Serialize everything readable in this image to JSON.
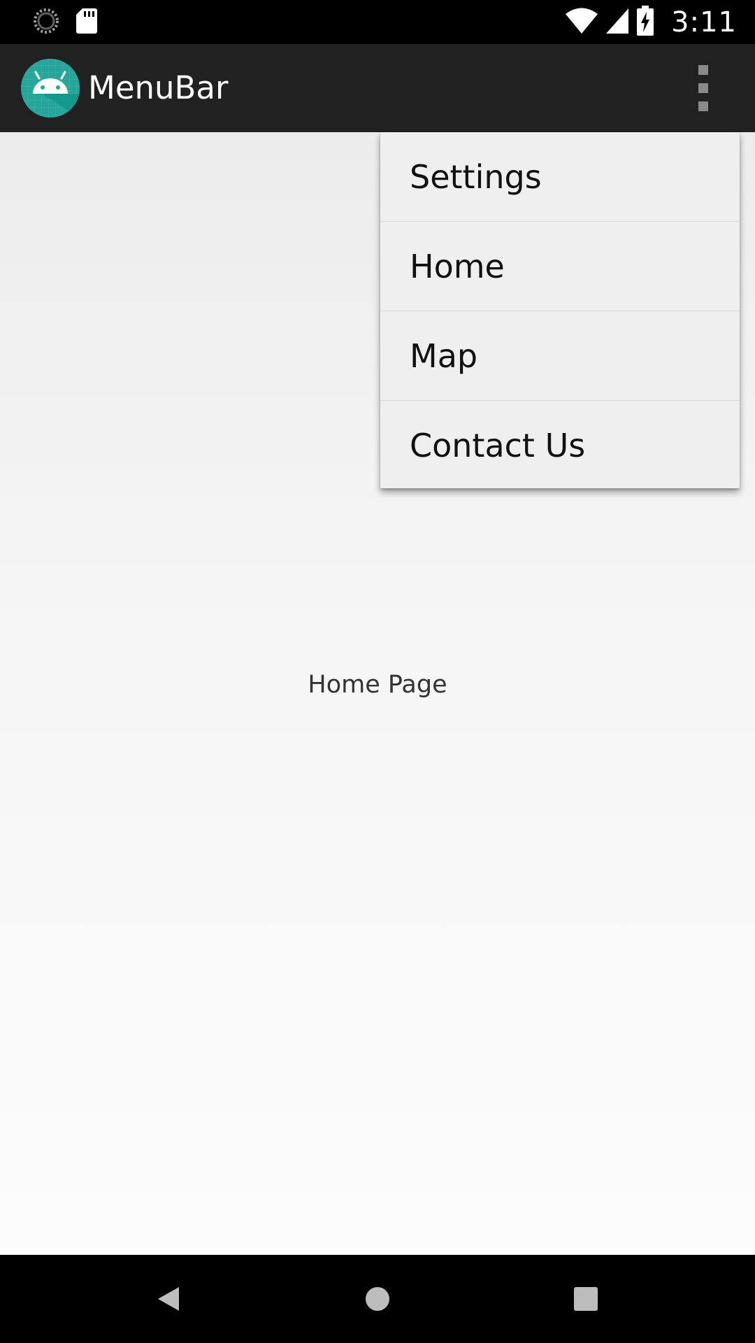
{
  "status_bar": {
    "time": "3:11",
    "icons": [
      "sync-icon",
      "sd-card-icon",
      "wifi-icon",
      "signal-icon",
      "battery-charging-icon"
    ]
  },
  "app_bar": {
    "title": "MenuBar",
    "logo_icon": "android-logo-icon",
    "overflow_icon": "more-vert-icon"
  },
  "menu": {
    "items": [
      {
        "label": "Settings"
      },
      {
        "label": "Home"
      },
      {
        "label": "Map"
      },
      {
        "label": "Contact Us"
      }
    ]
  },
  "main": {
    "text": "Home Page"
  },
  "nav_bar": {
    "icons": [
      "back-icon",
      "home-icon",
      "recents-icon"
    ]
  },
  "colors": {
    "app_bar": "#212121",
    "logo_bg": "#26a69a",
    "menu_bg": "#efefef",
    "status_bar": "#000000"
  }
}
